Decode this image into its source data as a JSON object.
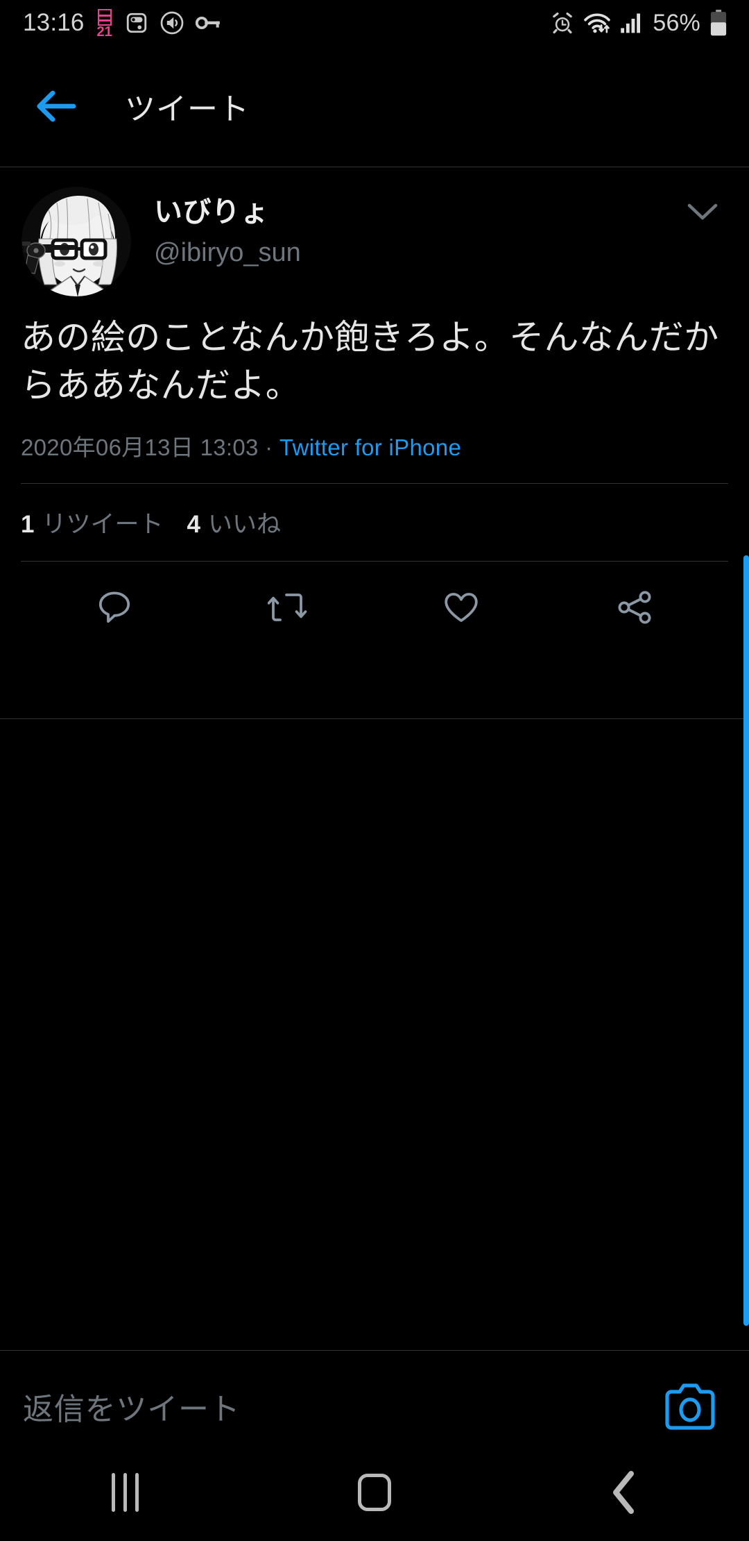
{
  "statusbar": {
    "time": "13:16",
    "calendar_badge": "21",
    "battery_percent": "56%",
    "left_icons": [
      "calendar-21-icon",
      "data-saver-icon",
      "volume-icon",
      "vpn-key-icon"
    ],
    "right_icons": [
      "alarm-icon",
      "wifi-icon",
      "signal-icon",
      "battery-icon"
    ],
    "colors": {
      "badge": "#ef3f8f",
      "text": "#d4d4d4"
    }
  },
  "appbar": {
    "title": "ツイート",
    "back_label": "back-arrow",
    "accent": "#1d9bf0"
  },
  "tweet": {
    "display_name": "いびりょ",
    "handle": "@ibiryo_sun",
    "avatar_alt": "manga-girl-with-glasses-avatar",
    "body": "あの絵のことなんか飽きろよ。そんなんだからああなんだよ。",
    "timestamp": "2020年06月13日 13:03",
    "separator": " · ",
    "source": "Twitter for iPhone",
    "stats": [
      {
        "count": "1",
        "label": "リツイート"
      },
      {
        "count": "4",
        "label": "いいね"
      }
    ],
    "actions": [
      {
        "name": "reply-icon",
        "label": "返信"
      },
      {
        "name": "retweet-icon",
        "label": "リツイート"
      },
      {
        "name": "like-icon",
        "label": "いいね"
      },
      {
        "name": "share-icon",
        "label": "共有"
      }
    ]
  },
  "reply_bar": {
    "placeholder": "返信をツイート",
    "camera_label": "camera-icon",
    "accent": "#1d9bf0"
  },
  "navbar": {
    "recents_label": "recents-button",
    "home_label": "home-button",
    "back_label": "back-button"
  },
  "colors": {
    "background": "#000000",
    "text_primary": "#e6e6e6",
    "text_secondary": "#6e767d",
    "divider": "#2f3336",
    "accent": "#1d9bf0"
  }
}
